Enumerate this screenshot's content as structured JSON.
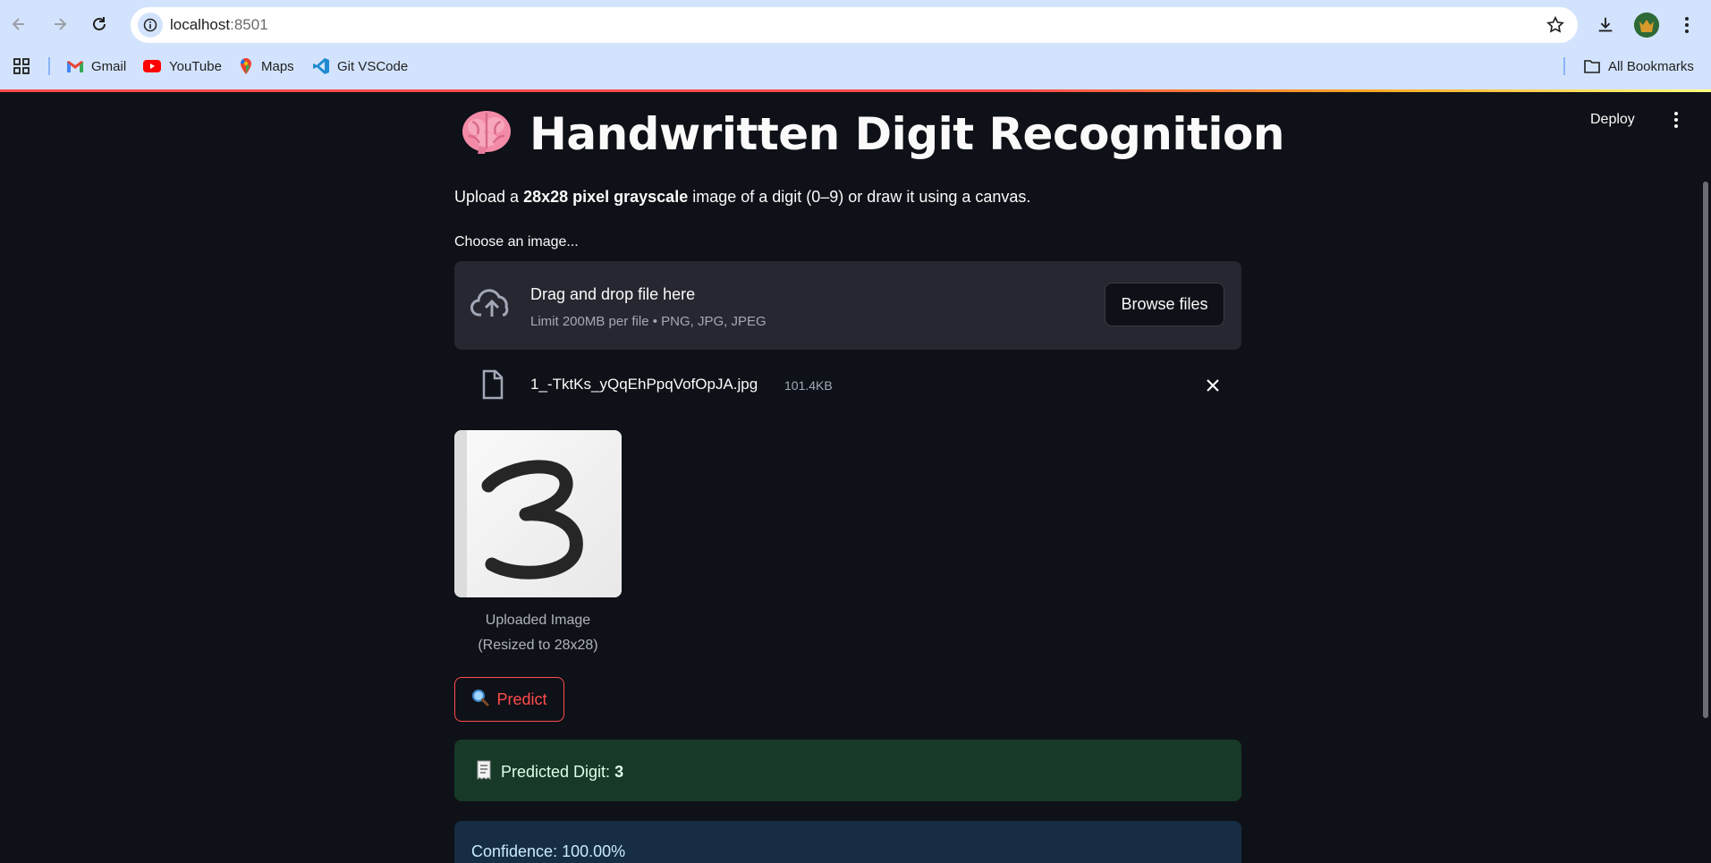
{
  "browser": {
    "url_host": "localhost",
    "url_port": ":8501",
    "bookmarks": [
      {
        "label": "Gmail",
        "icon": "gmail-icon"
      },
      {
        "label": "YouTube",
        "icon": "youtube-icon"
      },
      {
        "label": "Maps",
        "icon": "maps-icon"
      },
      {
        "label": "Git VSCode",
        "icon": "vscode-icon"
      }
    ],
    "all_bookmarks": "All Bookmarks"
  },
  "toolbar": {
    "deploy_label": "Deploy"
  },
  "page": {
    "title_emoji": "🧠",
    "title": "Handwritten Digit Recognition",
    "subtitle_pre": "Upload a ",
    "subtitle_bold": "28x28 pixel grayscale",
    "subtitle_post": " image of a digit (0–9) or draw it using a canvas."
  },
  "uploader": {
    "label": "Choose an image...",
    "drag_text": "Drag and drop file here",
    "limit_text": "Limit 200MB per file • PNG, JPG, JPEG",
    "browse_label": "Browse files",
    "file_name": "1_-TktKs_yQqEhPpqVofOpJA.jpg",
    "file_size": "101.4KB"
  },
  "image": {
    "digit": "3",
    "caption_line1": "Uploaded Image",
    "caption_line2": "(Resized to 28x28)"
  },
  "predict": {
    "emoji": "🔍",
    "label": "Predict"
  },
  "result": {
    "emoji": "🧾",
    "prefix": "Predicted Digit: ",
    "digit": "3",
    "confidence": "Confidence: 100.00%"
  },
  "colors": {
    "background": "#0e1117",
    "accent": "#ff4b4b",
    "success_bg": "#173928",
    "info_bg": "#172d43"
  }
}
